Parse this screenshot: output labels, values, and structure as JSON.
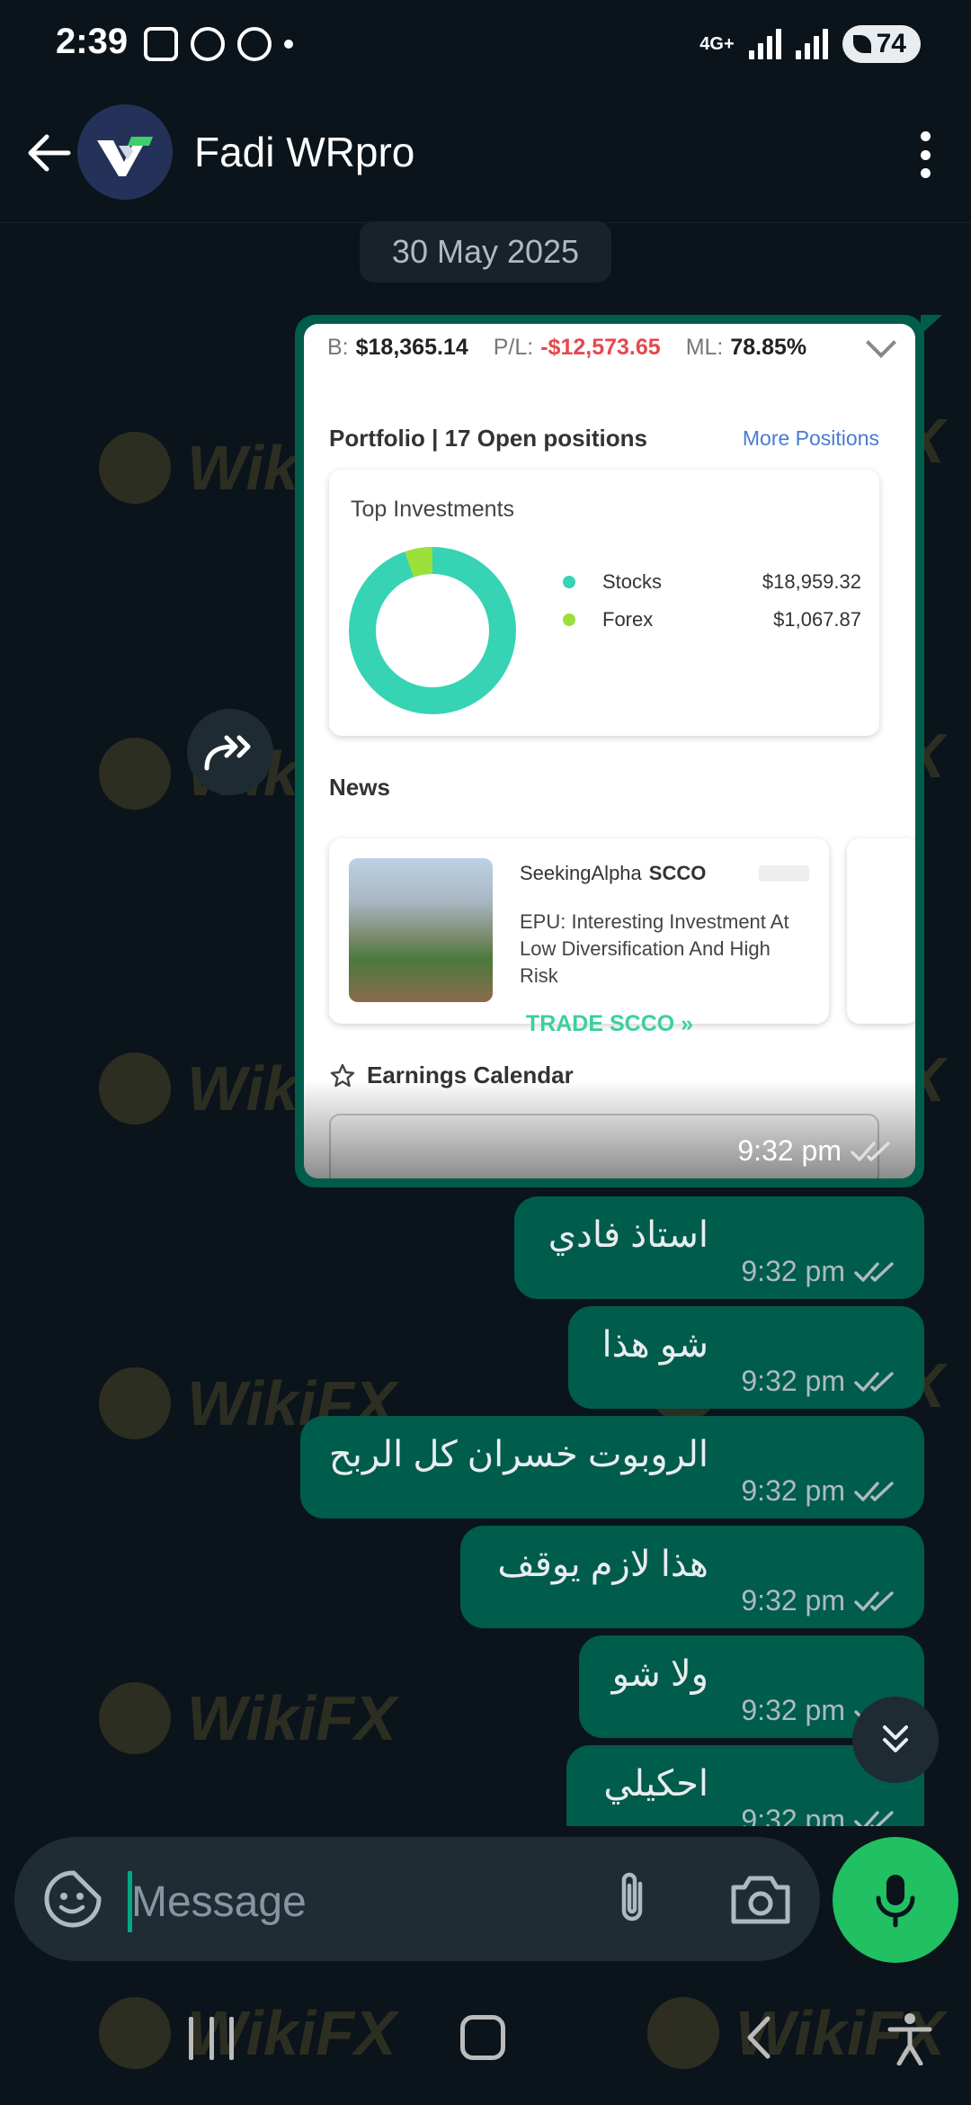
{
  "status_bar": {
    "time": "2:39",
    "network": "4G+",
    "battery": "74"
  },
  "header": {
    "contact_name": "Fadi WRpro"
  },
  "date_chip": "30 May 2025",
  "watermark": "WikiFX",
  "image_message": {
    "screenshot": {
      "balance_label": "B:",
      "balance": "$18,365.14",
      "pl_label": "P/L:",
      "pl": "-$12,573.65",
      "ml_label": "ML:",
      "ml": "78.85%",
      "portfolio_title": "Portfolio | 17 Open positions",
      "more_positions": "More Positions",
      "top_investments_title": "Top Investments",
      "investments": [
        {
          "name": "Stocks",
          "value": "$18,959.32",
          "color": "#36d3b4"
        },
        {
          "name": "Forex",
          "value": "$1,067.87",
          "color": "#9be03a"
        }
      ],
      "news_label": "News",
      "news": {
        "source": "SeekingAlpha",
        "ticker": "SCCO",
        "headline": "EPU: Interesting Investment At Low Diversification And High Risk"
      },
      "trade_button": "TRADE SCCO",
      "earnings_title": "Earnings Calendar"
    },
    "time": "9:32 pm"
  },
  "messages": [
    {
      "text": "استاذ فادي",
      "time": "9:32 pm"
    },
    {
      "text": "شو هذا",
      "time": "9:32 pm"
    },
    {
      "text": "الروبوت خسران كل الربح",
      "time": "9:32 pm"
    },
    {
      "text": "هذا لازم يوقف",
      "time": "9:32 pm"
    },
    {
      "text": "ولا شو",
      "time": "9:32 pm"
    },
    {
      "text": "احكيلي",
      "time": "9:32 pm"
    }
  ],
  "composer": {
    "placeholder": "Message"
  },
  "colors": {
    "background": "#0b141a",
    "outgoing_bubble": "#005c4b",
    "accent": "#21c063",
    "loss": "#e5484d"
  }
}
